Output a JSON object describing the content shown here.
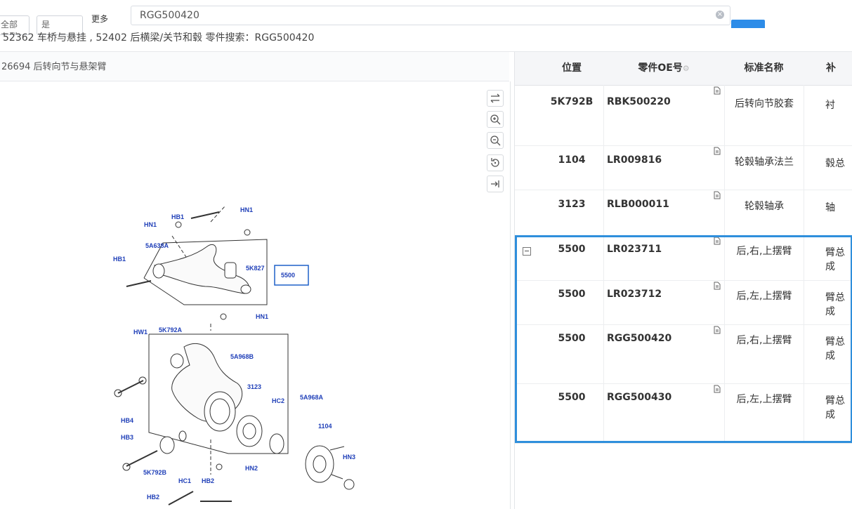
{
  "toolbar": {
    "btn1": "全部车型",
    "btn2": "是",
    "more": "更多",
    "search_value": "RGG500420",
    "clear_icon": "close-circle-icon"
  },
  "breadcrumb": "52362 车桥与悬挂 , 52402 后横梁/关节和毂 零件搜索：RGG500420",
  "diagram": {
    "title": "26694 后转向节与悬架臂",
    "tools": [
      "swap-icon",
      "zoom-in-icon",
      "zoom-out-icon",
      "reset-icon",
      "collapse-panel-icon"
    ],
    "callout": "5500",
    "labels": {
      "HB1a": "HB1",
      "HN1a": "HN1",
      "HN1b": "HN1",
      "A638": "5A638A",
      "HB1b": "HB1",
      "K827": "5K827",
      "HN1c": "HN1",
      "HW1": "HW1",
      "K792A": "5K792A",
      "A968B": "5A968B",
      "n3123": "3123",
      "HC2": "HC2",
      "A968A": "5A968A",
      "HB4": "HB4",
      "HB3": "HB3",
      "n1104": "1104",
      "HN3": "HN3",
      "HN2": "HN2",
      "K792B": "5K792B",
      "HC1": "HC1",
      "HB2a": "HB2",
      "HB2b": "HB2"
    }
  },
  "table": {
    "headers": {
      "pos": "位置",
      "oe": "零件OE号",
      "name": "标准名称",
      "ext": "补"
    },
    "rows": [
      {
        "pos": "5K792B",
        "oe": "RBK500220",
        "name": "后转向节胶套",
        "ext": "衬"
      },
      {
        "pos": "1104",
        "oe": "LR009816",
        "name": "轮毂轴承法兰",
        "ext": "毂总"
      },
      {
        "pos": "3123",
        "oe": "RLB000011",
        "name": "轮毂轴承",
        "ext": "轴"
      },
      {
        "pos": "5500",
        "oe": "LR023711",
        "name": "后,右,上摆臂",
        "ext": "臂总成"
      },
      {
        "pos": "5500",
        "oe": "LR023712",
        "name": "后,左,上摆臂",
        "ext": "臂总成"
      },
      {
        "pos": "5500",
        "oe": "RGG500420",
        "name": "后,右,上摆臂",
        "ext": "臂总成"
      },
      {
        "pos": "5500",
        "oe": "RGG500430",
        "name": "后,左,上摆臂",
        "ext": "臂总成"
      }
    ]
  }
}
